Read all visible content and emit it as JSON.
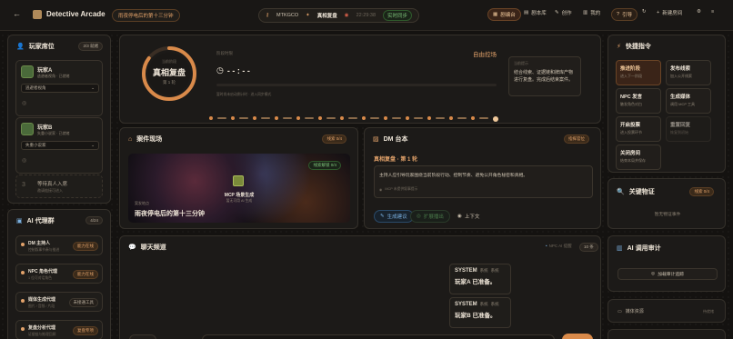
{
  "topbar": {
    "back_glyph": "←",
    "app_title": "Detective Arcade",
    "story_tag": "雨夜停电后的第十三分钟",
    "room_code": "MTKGCO",
    "stage": "真相复盘",
    "timer": "22:29:38",
    "live": "实时同步",
    "nav": {
      "script_edit": "剧编台",
      "script_lib": "剧本库",
      "create": "创作",
      "mine": "我的",
      "guide": "引导",
      "new_room": "新建房间"
    }
  },
  "players_panel": {
    "title": "玩家席位",
    "badge": "2/3 就绪",
    "players": [
      {
        "name": "玩家A",
        "desc": "逃避者视角 · 已就绪",
        "select": "逃避者视角"
      },
      {
        "name": "玩家B",
        "desc": "失重小说家 · 已就绪",
        "select": "失重小说家"
      }
    ],
    "waiting": {
      "title": "等待真人入席",
      "desc": "邀请链接可进入"
    }
  },
  "agents_panel": {
    "title": "AI 代理群",
    "badge": "4/24",
    "agents": [
      {
        "name": "DM 主持人",
        "desc": "控制叙事节奏与推进",
        "tag": "能力在线"
      },
      {
        "name": "NPC 角色代理",
        "desc": "1 位可对话角色",
        "tag": "能力在线"
      },
      {
        "name": "媒体生成代理",
        "desc": "图片 / 音频 / 片段",
        "tag": "未接通工具"
      },
      {
        "name": "复盘分析代理",
        "desc": "证据链与推理回顾",
        "tag": "复盘专项"
      }
    ]
  },
  "stage_panel": {
    "ring_top": "当前阶段",
    "ring_title": "真相复盘",
    "ring_round": "第 1 轮",
    "meta_label": "阶段时限",
    "clock": "- - : - -",
    "note": "暂时尚未启动倒计时 · 进入同步模式",
    "free_label": "自由控场",
    "info_title": "当前提示",
    "info_text": "结合线索、证据链和牌库产物进行复盘。完成后结束案件。"
  },
  "scene_panel": {
    "title": "案件现场",
    "badge": "线索 0/4",
    "img_badge": "线索解锁 0/4",
    "img_label": "MCP 场景生成",
    "img_sub": "暂无可用 AI 生成",
    "place_label": "案发地点",
    "place_title": "雨夜停电后的第十三分钟"
  },
  "dm_panel": {
    "title": "DM 台本",
    "badge": "指挥官位",
    "section": "真相复盘 · 第 1 轮",
    "text": "主持人应引导玩家围绕当前阶段行动、控制节奏、避免公开角色秘密和真相。",
    "status": "MCP 未提供叙事提示",
    "btn_generate": "生成建议",
    "btn_expand": "扩展播出",
    "btn_context": "上下文"
  },
  "chat_panel": {
    "title": "聊天频道",
    "hint": "NPC AI 提醒",
    "badge": "10 条",
    "messages": [
      {
        "sender": "SYSTEM",
        "meta1": "系统",
        "meta2": "系统",
        "body": "玩家A 已准备。"
      },
      {
        "sender": "SYSTEM",
        "meta1": "系统",
        "meta2": "系统",
        "body": "玩家B 已准备。"
      }
    ]
  },
  "commands_panel": {
    "title": "快捷指令",
    "commands": [
      {
        "title": "推进阶段",
        "desc": "进入下一阶段"
      },
      {
        "title": "发布线索",
        "desc": "加入公开线索"
      },
      {
        "title": "NPC 发言",
        "desc": "触发角色对白"
      },
      {
        "title": "生成媒体",
        "desc": "调用 MCP 工具"
      },
      {
        "title": "开启投票",
        "desc": "进入投票环节"
      },
      {
        "title": "重置回复",
        "desc": "恢复到初始"
      },
      {
        "title": "关闭房间",
        "desc": "结束本局并保存"
      }
    ]
  },
  "evidence_panel": {
    "title": "关键物证",
    "badge": "线索 0/4",
    "empty": "暂无物证事件"
  },
  "audit_panel": {
    "title": "AI 调用审计",
    "btn": "加载审计追踪"
  },
  "media_panel": {
    "title": "媒体资源",
    "tag": "待就绪"
  },
  "colors": {
    "accent": "#e2a26a",
    "bg": "#141210",
    "panel": "#1c1a18",
    "active": "#3a2418"
  }
}
